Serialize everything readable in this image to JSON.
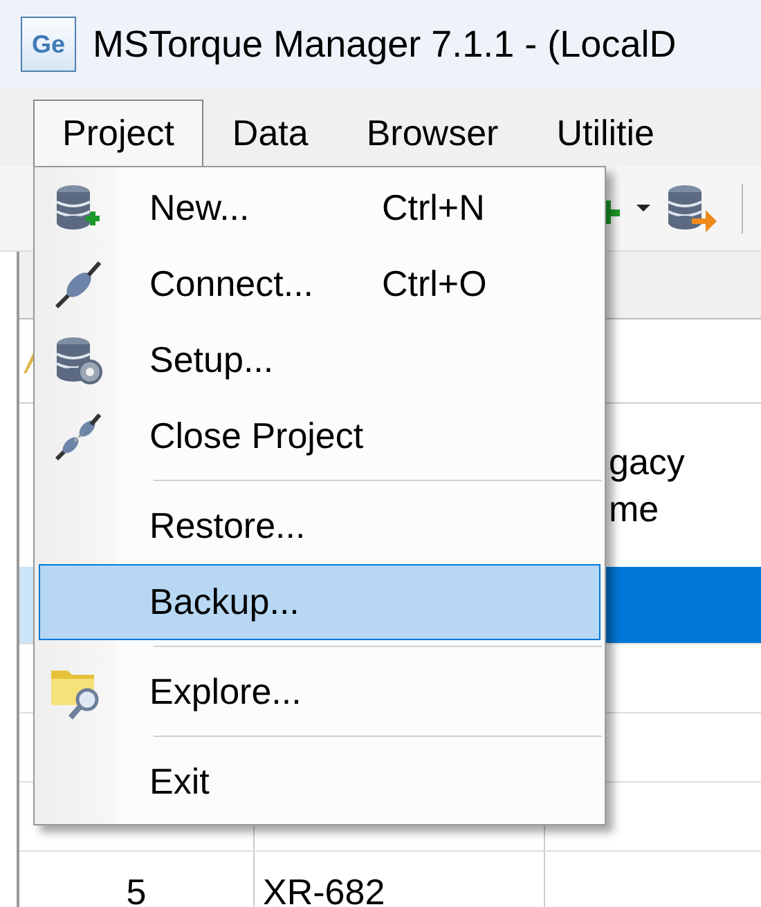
{
  "window": {
    "logo_text": "Ge",
    "title": "MSTorque Manager 7.1.1 - (LocalD"
  },
  "menubar": [
    {
      "label": "Project",
      "selected": true
    },
    {
      "label": "Data",
      "selected": false
    },
    {
      "label": "Browser",
      "selected": false
    },
    {
      "label": "Utilitie",
      "selected": false
    }
  ],
  "table": {
    "column_3_heading": [
      "gacy",
      "me"
    ],
    "rows": [
      {
        "selected": true,
        "cells": []
      },
      {
        "selected": false,
        "cells": []
      },
      {
        "selected": false,
        "cells": []
      },
      {
        "selected": false,
        "cells": []
      },
      {
        "selected": false,
        "cells": [
          "5",
          "XR-682"
        ]
      }
    ]
  },
  "project_menu": [
    {
      "kind": "item",
      "label": "New...",
      "shortcut": "Ctrl+N",
      "selected": false
    },
    {
      "kind": "item",
      "label": "Connect...",
      "shortcut": "Ctrl+O",
      "selected": false
    },
    {
      "kind": "item",
      "label": "Setup...",
      "selected": false
    },
    {
      "kind": "item",
      "label": "Close Project",
      "selected": false
    },
    {
      "kind": "separator"
    },
    {
      "kind": "item",
      "label": "Restore...",
      "selected": false
    },
    {
      "kind": "item",
      "label": "Backup...",
      "selected": true
    },
    {
      "kind": "separator"
    },
    {
      "kind": "item",
      "label": "Explore...",
      "selected": false
    },
    {
      "kind": "separator"
    },
    {
      "kind": "item",
      "label": "Exit",
      "selected": false
    }
  ]
}
